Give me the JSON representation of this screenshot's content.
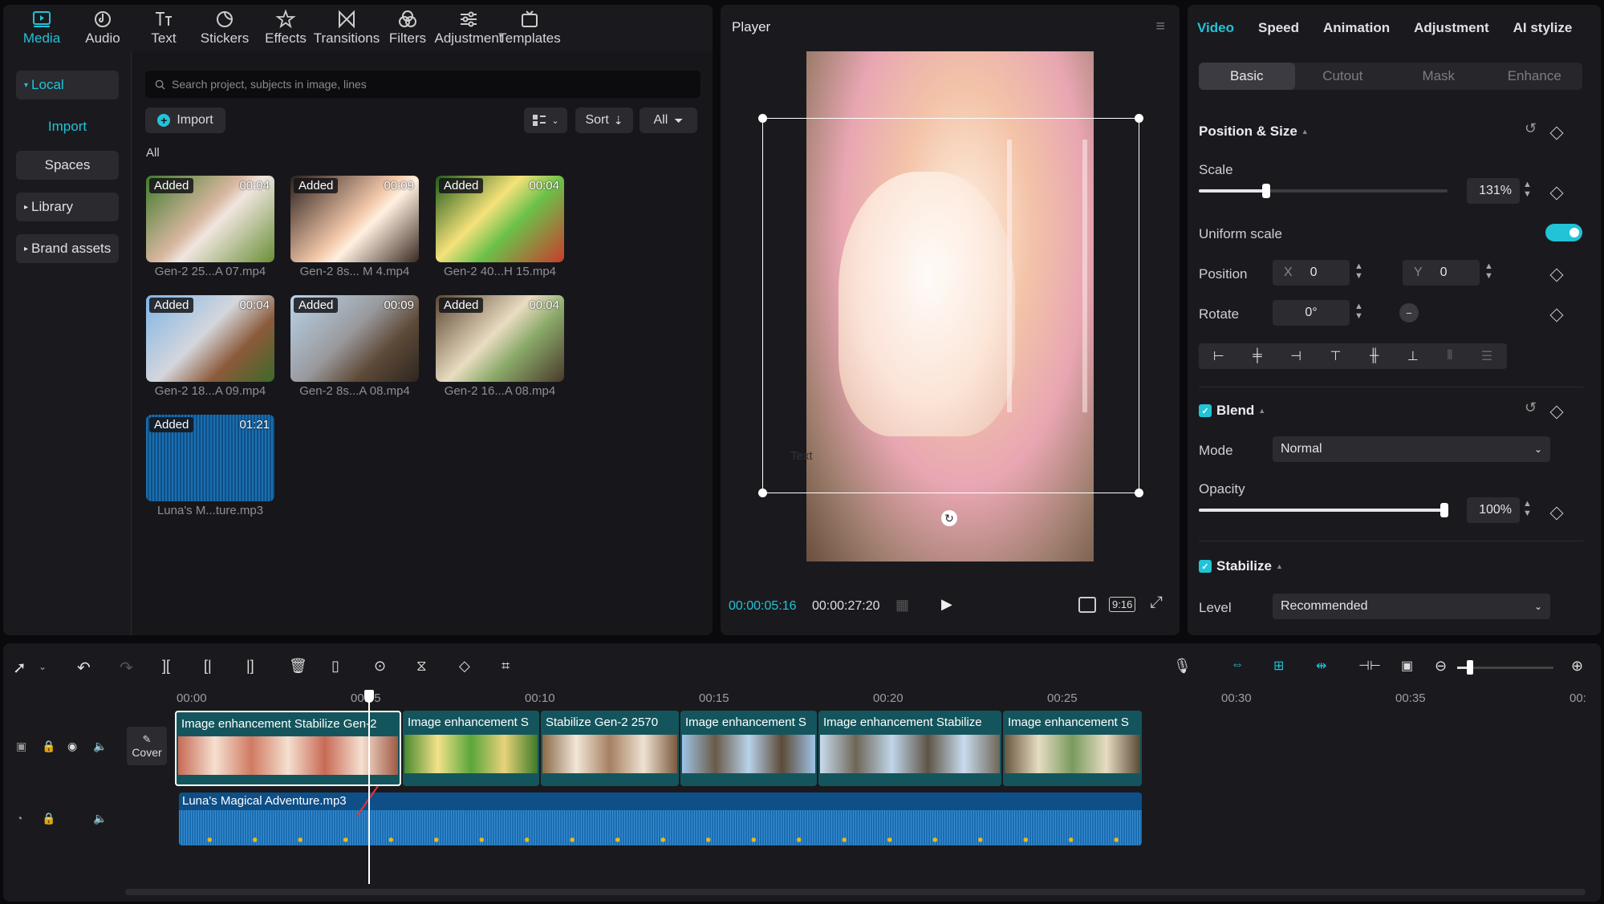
{
  "media_tabs": [
    {
      "label": "Media",
      "icon": "media-icon",
      "active": true
    },
    {
      "label": "Audio",
      "icon": "audio-icon"
    },
    {
      "label": "Text",
      "icon": "text-icon"
    },
    {
      "label": "Stickers",
      "icon": "stickers-icon"
    },
    {
      "label": "Effects",
      "icon": "effects-icon"
    },
    {
      "label": "Transitions",
      "icon": "transitions-icon"
    },
    {
      "label": "Filters",
      "icon": "filters-icon"
    },
    {
      "label": "Adjustment",
      "icon": "adjustment-icon"
    },
    {
      "label": "Templates",
      "icon": "templates-icon"
    }
  ],
  "sidebar": {
    "local": "Local",
    "import": "Import",
    "spaces": "Spaces",
    "library": "Library",
    "brand": "Brand assets"
  },
  "media": {
    "search_placeholder": "Search project, subjects in image, lines",
    "import_label": "Import",
    "sort_label": "Sort",
    "all_filter": "All",
    "section_all": "All",
    "items": [
      {
        "badge": "Added",
        "duration": "00:04",
        "name": "Gen-2 25...A 07.mp4"
      },
      {
        "badge": "Added",
        "duration": "00:09",
        "name": "Gen-2 8s... M 4.mp4"
      },
      {
        "badge": "Added",
        "duration": "00:04",
        "name": "Gen-2 40...H 15.mp4"
      },
      {
        "badge": "Added",
        "duration": "00:04",
        "name": "Gen-2 18...A 09.mp4"
      },
      {
        "badge": "Added",
        "duration": "00:09",
        "name": "Gen-2 8s...A 08.mp4"
      },
      {
        "badge": "Added",
        "duration": "00:04",
        "name": "Gen-2 16...A 08.mp4"
      },
      {
        "badge": "Added",
        "duration": "01:21",
        "name": "Luna's M...ture.mp3"
      }
    ]
  },
  "player": {
    "title": "Player",
    "current_time": "00:00:05:16",
    "total_time": "00:00:27:20",
    "aspect": "9:16",
    "overlay_text": "Text"
  },
  "props": {
    "tabs": [
      "Video",
      "Speed",
      "Animation",
      "Adjustment",
      "AI stylize"
    ],
    "subtabs": [
      "Basic",
      "Cutout",
      "Mask",
      "Enhance"
    ],
    "position_size": "Position & Size",
    "scale_label": "Scale",
    "scale_value": "131%",
    "scale_fraction": 0.27,
    "uniform_label": "Uniform scale",
    "position_label": "Position",
    "x_label": "X",
    "x_value": "0",
    "y_label": "Y",
    "y_value": "0",
    "rotate_label": "Rotate",
    "rotate_value": "0°",
    "blend_label": "Blend",
    "mode_label": "Mode",
    "mode_value": "Normal",
    "opacity_label": "Opacity",
    "opacity_value": "100%",
    "opacity_fraction": 1.0,
    "stabilize_label": "Stabilize",
    "level_label": "Level",
    "level_value": "Recommended"
  },
  "timeline": {
    "ruler": [
      "00:00",
      "00:05",
      "00:10",
      "00:15",
      "00:20",
      "00:25",
      "00:30",
      "00:35",
      "00:"
    ],
    "cover_label": "Cover",
    "clips": [
      "Image enhancement  Stabilize  Gen-2",
      "Image enhancement  S",
      "Stabilize  Gen-2 2570",
      "Image enhancement  S",
      "Image enhancement  Stabilize",
      "Image enhancement  S"
    ],
    "audio_label": "Luna's Magical Adventure.mp3"
  },
  "colors": {
    "accent": "#22c3d7",
    "clip": "#14555d",
    "audio": "#0e4f88"
  }
}
